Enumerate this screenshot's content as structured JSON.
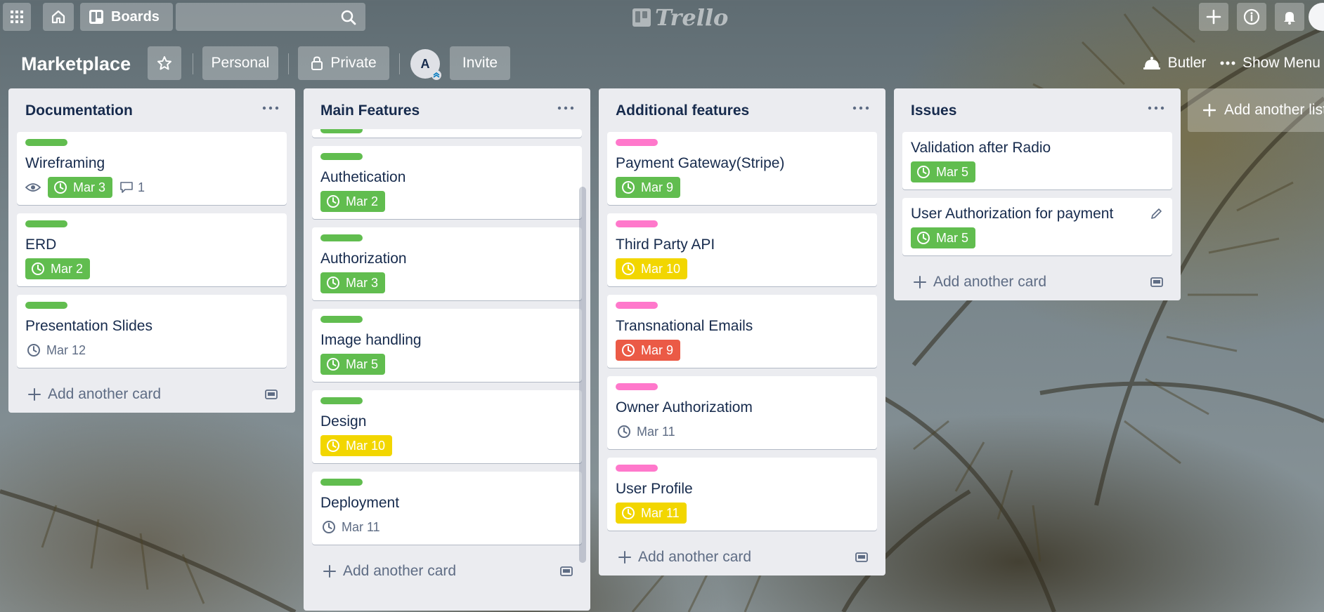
{
  "topbar": {
    "boards_label": "Boards",
    "logo_text": "Trello"
  },
  "board": {
    "title": "Marketplace",
    "visibility_team": "Personal",
    "visibility_privacy": "Private",
    "member_initial": "A",
    "invite_label": "Invite",
    "butler_label": "Butler",
    "show_menu_label": "Show Menu",
    "add_list_label": "Add another list"
  },
  "colors": {
    "label_green": "#61bd4f",
    "label_pink": "#ff78cb",
    "due_green": "#61bd4f",
    "due_yellow": "#f2d600",
    "due_red": "#eb5a46"
  },
  "lists": [
    {
      "title": "Documentation",
      "add_card_label": "Add another card",
      "cards": [
        {
          "title": "Wireframing",
          "label": "green",
          "due": "Mar 3",
          "due_style": "green",
          "watch": true,
          "comments": "1"
        },
        {
          "title": "ERD",
          "label": "green",
          "due": "Mar 2",
          "due_style": "green"
        },
        {
          "title": "Presentation Slides",
          "label": "green",
          "due": "Mar 12",
          "due_style": "plain"
        }
      ]
    },
    {
      "title": "Main Features",
      "add_card_label": "Add another card",
      "cards": [
        {
          "title": "Authetication",
          "label": "green",
          "due": "Mar 2",
          "due_style": "green"
        },
        {
          "title": "Authorization",
          "label": "green",
          "due": "Mar 3",
          "due_style": "green"
        },
        {
          "title": "Image handling",
          "label": "green",
          "due": "Mar 5",
          "due_style": "green"
        },
        {
          "title": "Design",
          "label": "green",
          "due": "Mar 10",
          "due_style": "yellow"
        },
        {
          "title": "Deployment",
          "label": "green",
          "due": "Mar 11",
          "due_style": "plain"
        }
      ]
    },
    {
      "title": "Additional features",
      "add_card_label": "Add another card",
      "cards": [
        {
          "title": "Payment Gateway(Stripe)",
          "label": "pink",
          "due": "Mar 9",
          "due_style": "green"
        },
        {
          "title": "Third Party API",
          "label": "pink",
          "due": "Mar 10",
          "due_style": "yellow"
        },
        {
          "title": "Transnational Emails",
          "label": "pink",
          "due": "Mar 9",
          "due_style": "red"
        },
        {
          "title": "Owner Authorizatiom",
          "label": "pink",
          "due": "Mar 11",
          "due_style": "plain"
        },
        {
          "title": "User Profile",
          "label": "pink",
          "due": "Mar 11",
          "due_style": "yellow"
        }
      ]
    },
    {
      "title": "Issues",
      "add_card_label": "Add another card",
      "cards": [
        {
          "title": "Validation after Radio",
          "due": "Mar 5",
          "due_style": "green"
        },
        {
          "title": "User Authorization for payment",
          "due": "Mar 5",
          "due_style": "green",
          "editable": true
        }
      ]
    }
  ]
}
